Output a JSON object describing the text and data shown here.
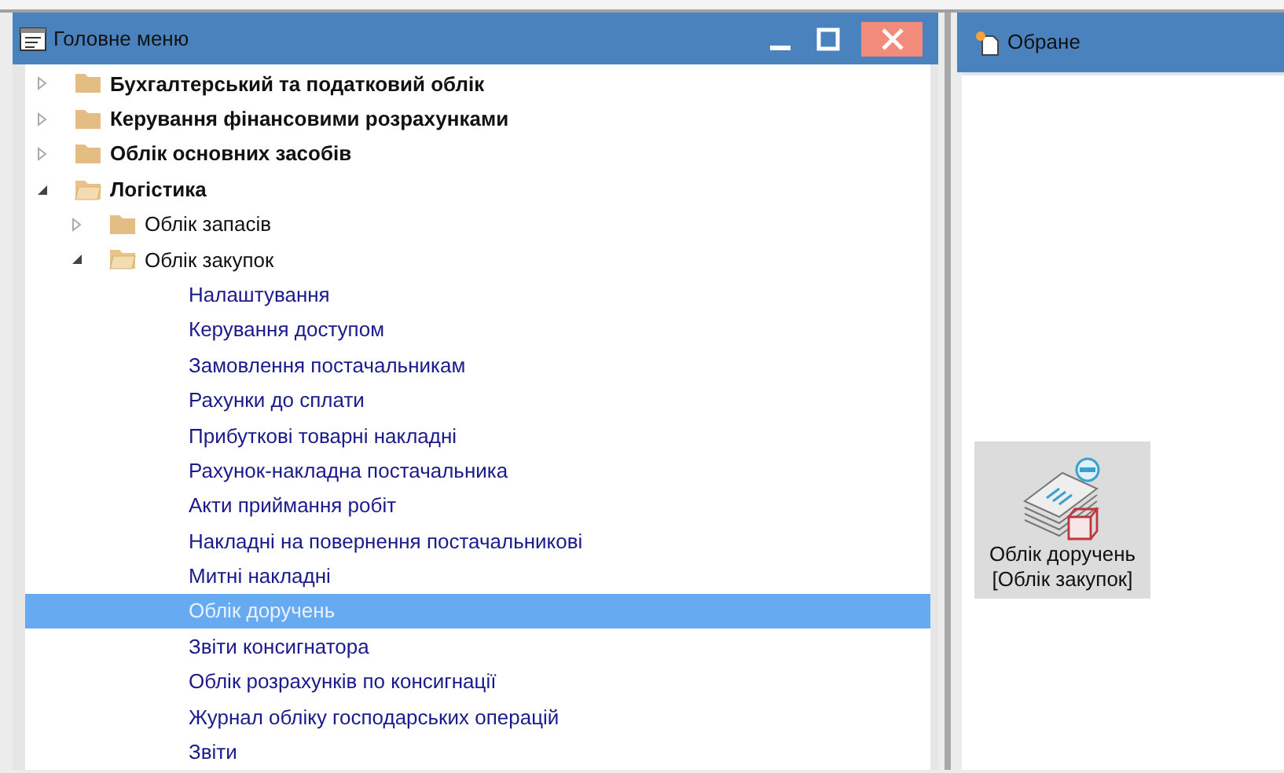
{
  "main_menu": {
    "title": "Головне меню",
    "items": [
      {
        "kind": "folder",
        "label": "Бухгалтерський та податковий облік",
        "expanded": false
      },
      {
        "kind": "folder",
        "label": "Керування фінансовими розрахунками",
        "expanded": false
      },
      {
        "kind": "folder",
        "label": "Облік основних засобів",
        "expanded": false
      },
      {
        "kind": "folder",
        "label": "Логістика",
        "expanded": true,
        "children": [
          {
            "kind": "folder",
            "label": "Облік запасів",
            "expanded": false
          },
          {
            "kind": "folder",
            "label": "Облік закупок",
            "expanded": true,
            "children": [
              {
                "kind": "item",
                "label": "Налаштування",
                "selected": false
              },
              {
                "kind": "item",
                "label": "Керування доступом",
                "selected": false
              },
              {
                "kind": "item",
                "label": "Замовлення постачальникам",
                "selected": false
              },
              {
                "kind": "item",
                "label": "Рахунки до сплати",
                "selected": false
              },
              {
                "kind": "item",
                "label": "Прибуткові товарні накладні",
                "selected": false
              },
              {
                "kind": "item",
                "label": "Рахунок-накладна постачальника",
                "selected": false
              },
              {
                "kind": "item",
                "label": "Акти приймання робіт",
                "selected": false
              },
              {
                "kind": "item",
                "label": "Накладні на повернення постачальникові",
                "selected": false
              },
              {
                "kind": "item",
                "label": "Митні накладні",
                "selected": false
              },
              {
                "kind": "item",
                "label": "Облік доручень",
                "selected": true
              },
              {
                "kind": "item",
                "label": "Звіти консигнатора",
                "selected": false
              },
              {
                "kind": "item",
                "label": "Облік розрахунків по консигнації",
                "selected": false
              },
              {
                "kind": "item",
                "label": "Журнал обліку господарських операцій",
                "selected": false
              },
              {
                "kind": "item",
                "label": "Звіти",
                "selected": false
              }
            ]
          }
        ]
      }
    ]
  },
  "favorites": {
    "title": "Обране",
    "tiles": [
      {
        "label": "Облік доручень",
        "sublabel": "[Облік закупок]"
      }
    ]
  }
}
